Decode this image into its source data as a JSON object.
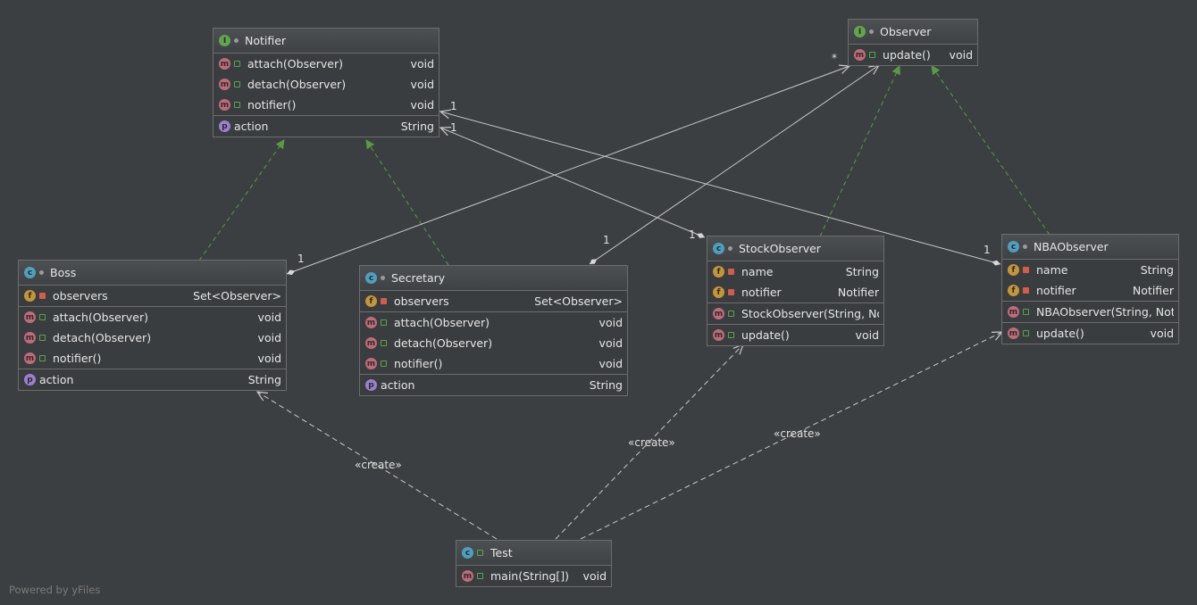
{
  "colors": {
    "background": "#3c3f41",
    "realization": "#5a9a45",
    "association": "#c8c8c8",
    "dependency": "#c8c8c8"
  },
  "classes": {
    "notifier": {
      "badge": "I",
      "name": "Notifier",
      "members": [
        {
          "badge": "m",
          "name": "attach(Observer)",
          "type": "void"
        },
        {
          "badge": "m",
          "name": "detach(Observer)",
          "type": "void"
        },
        {
          "badge": "m",
          "name": "notifier()",
          "type": "void"
        }
      ],
      "props": [
        {
          "badge": "p",
          "name": "action",
          "type": "String"
        }
      ]
    },
    "observer": {
      "badge": "I",
      "name": "Observer",
      "members": [
        {
          "badge": "m",
          "name": "update()",
          "type": "void"
        }
      ]
    },
    "boss": {
      "badge": "c",
      "name": "Boss",
      "fields": [
        {
          "badge": "f",
          "name": "observers",
          "type": "Set<Observer>"
        }
      ],
      "members": [
        {
          "badge": "m",
          "name": "attach(Observer)",
          "type": "void"
        },
        {
          "badge": "m",
          "name": "detach(Observer)",
          "type": "void"
        },
        {
          "badge": "m",
          "name": "notifier()",
          "type": "void"
        }
      ],
      "props": [
        {
          "badge": "p",
          "name": "action",
          "type": "String"
        }
      ]
    },
    "secretary": {
      "badge": "c",
      "name": "Secretary",
      "fields": [
        {
          "badge": "f",
          "name": "observers",
          "type": "Set<Observer>"
        }
      ],
      "members": [
        {
          "badge": "m",
          "name": "attach(Observer)",
          "type": "void"
        },
        {
          "badge": "m",
          "name": "detach(Observer)",
          "type": "void"
        },
        {
          "badge": "m",
          "name": "notifier()",
          "type": "void"
        }
      ],
      "props": [
        {
          "badge": "p",
          "name": "action",
          "type": "String"
        }
      ]
    },
    "stock": {
      "badge": "c",
      "name": "StockObserver",
      "fields": [
        {
          "badge": "f",
          "name": "name",
          "type": "String"
        },
        {
          "badge": "f",
          "name": "notifier",
          "type": "Notifier"
        }
      ],
      "ctors": [
        {
          "badge": "m",
          "name": "StockObserver(String, Notifier)",
          "type": ""
        }
      ],
      "members": [
        {
          "badge": "m",
          "name": "update()",
          "type": "void"
        }
      ]
    },
    "nba": {
      "badge": "c",
      "name": "NBAObserver",
      "fields": [
        {
          "badge": "f",
          "name": "name",
          "type": "String"
        },
        {
          "badge": "f",
          "name": "notifier",
          "type": "Notifier"
        }
      ],
      "ctors": [
        {
          "badge": "m",
          "name": "NBAObserver(String, Notifier)",
          "type": ""
        }
      ],
      "members": [
        {
          "badge": "m",
          "name": "update()",
          "type": "void"
        }
      ]
    },
    "test": {
      "badge": "c",
      "name": "Test",
      "members": [
        {
          "badge": "m",
          "name": "main(String[])",
          "type": "void"
        }
      ]
    }
  },
  "labels": {
    "create": "«create»",
    "one": "1",
    "many": "*"
  },
  "watermark": "Powered by yFiles"
}
